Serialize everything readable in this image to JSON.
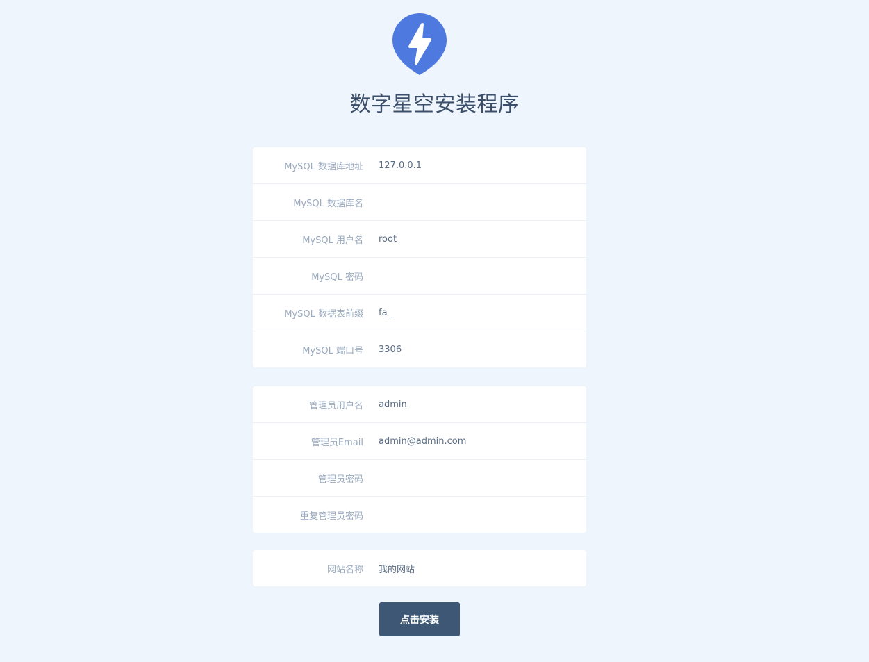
{
  "header": {
    "logo_icon": "lightning-bolt-icon",
    "title": "数字星空安装程序",
    "brand_color": "#4e79df"
  },
  "database_section": {
    "fields": [
      {
        "label": "MySQL 数据库地址",
        "value": "127.0.0.1"
      },
      {
        "label": "MySQL 数据库名",
        "value": ""
      },
      {
        "label": "MySQL 用户名",
        "value": "root"
      },
      {
        "label": "MySQL 密码",
        "value": ""
      },
      {
        "label": "MySQL 数据表前缀",
        "value": "fa_"
      },
      {
        "label": "MySQL 端口号",
        "value": "3306"
      }
    ]
  },
  "admin_section": {
    "fields": [
      {
        "label": "管理员用户名",
        "value": "admin"
      },
      {
        "label": "管理员Email",
        "value": "admin@admin.com"
      },
      {
        "label": "管理员密码",
        "value": ""
      },
      {
        "label": "重复管理员密码",
        "value": ""
      }
    ]
  },
  "site_section": {
    "fields": [
      {
        "label": "网站名称",
        "value": "我的网站"
      }
    ]
  },
  "install_button": {
    "label": "点击安装",
    "color": "#3e5775"
  }
}
